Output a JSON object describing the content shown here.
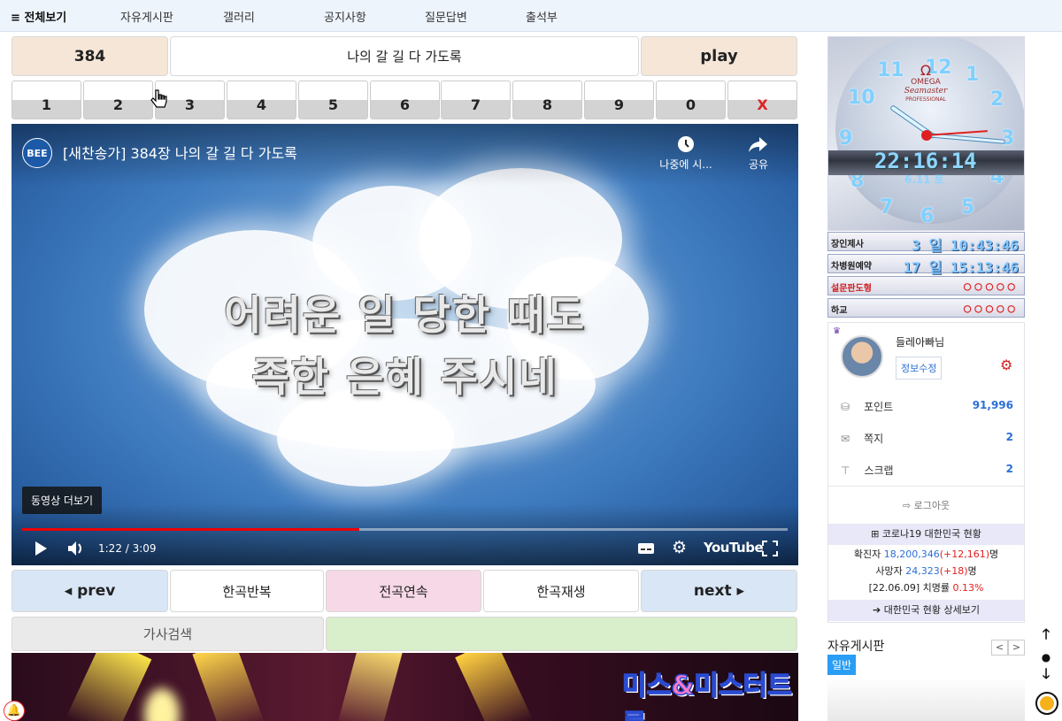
{
  "nav": {
    "all": "≡ 전체보기",
    "items": [
      "자유게시판",
      "갤러리",
      "공지사항",
      "질문답변",
      "출석부"
    ]
  },
  "player": {
    "song_number": "384",
    "song_title": "나의 갈 길 다 가도록",
    "play_label": "play",
    "keypad": [
      "1",
      "2",
      "3",
      "4",
      "5",
      "6",
      "7",
      "8",
      "9",
      "0",
      "X"
    ]
  },
  "video": {
    "channel": "BEE",
    "title": "[새찬송가] 384장 나의 갈 길 다 가도록",
    "watch_later": "나중에 시...",
    "share": "공유",
    "lyric_line1": "어려운 일 당한 때도",
    "lyric_line2": "족한 은혜 주시네",
    "more_videos": "동영상 더보기",
    "time": "1:22 / 3:09",
    "progress": 0.44,
    "youtube": "YouTube"
  },
  "controls": {
    "prev": "◂ prev",
    "repeat_one": "한곡반복",
    "play_all": "전곡연속",
    "play_one": "한곡재생",
    "next": "next ▸",
    "lyrics_search": "가사검색"
  },
  "banner": {
    "text": "미스&미스터트롯"
  },
  "clock": {
    "brand": "OMEGA",
    "model": "Seamaster",
    "sub": "PROFESSIONAL",
    "time": "22:16:14",
    "date": "6.11 토",
    "numbers": [
      "12",
      "1",
      "2",
      "3",
      "4",
      "5",
      "6",
      "7",
      "8",
      "9",
      "10",
      "11"
    ]
  },
  "timers": [
    {
      "label": "장인제사",
      "value": "3 일 10:43:46"
    },
    {
      "label": "차병원예약",
      "value": "17 일 15:13:46"
    },
    {
      "label": "설문판도형",
      "value": "○○○○○"
    },
    {
      "label": "하교",
      "value": "○○○○○"
    }
  ],
  "profile": {
    "name": "들레아빠님",
    "edit_label": "정보수정",
    "rows": [
      {
        "label": "포인트",
        "value": "91,996"
      },
      {
        "label": "쪽지",
        "value": "2"
      },
      {
        "label": "스크랩",
        "value": "2"
      }
    ],
    "logout": "로그아웃"
  },
  "covid": {
    "header": "코로나19 대한민국 현황",
    "confirmed_prefix": "확진자 ",
    "confirmed": "18,200,346",
    "confirmed_delta": "(+12,161)",
    "unit": "명",
    "deaths_prefix": "사망자 ",
    "deaths": "24,323",
    "deaths_delta": "(+18)",
    "rate_prefix": "[22.06.09] 치명률 ",
    "rate": "0.13%",
    "detail_link": "대한민국 현황 상세보기"
  },
  "board": {
    "title": "자유게시판",
    "tab": "일반",
    "prev": "<",
    "next": ">"
  },
  "colors": {
    "accent_blue": "#2a6fd6",
    "peach": "#f5e6d8",
    "light_blue": "#d8e6f6",
    "pink": "#f6d8e6",
    "light_green": "#d9eecb",
    "red": "#e02020"
  }
}
